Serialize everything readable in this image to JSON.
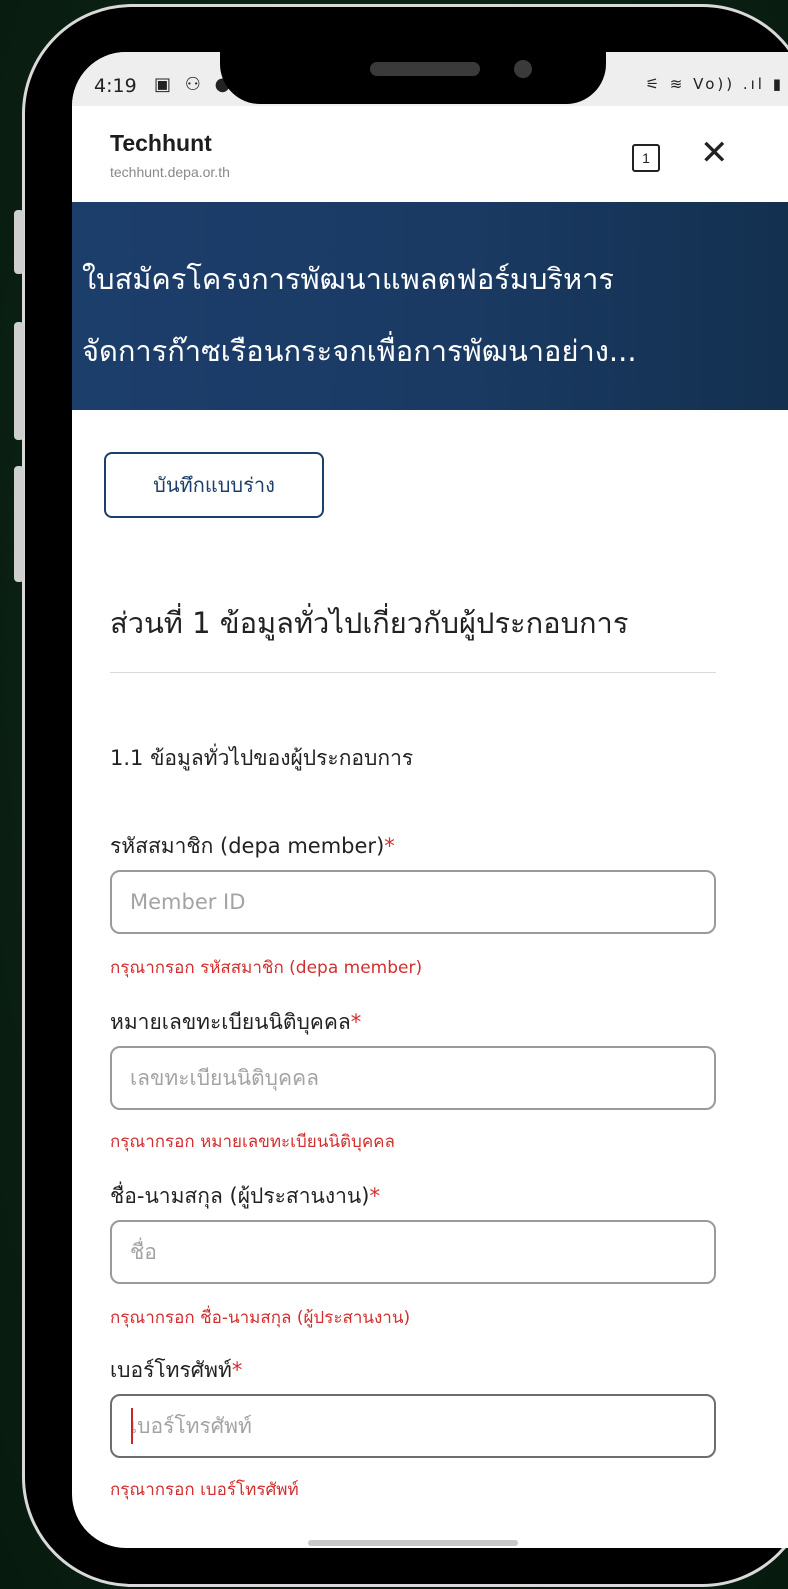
{
  "status_bar": {
    "time": "4:19",
    "left_icons": "▣ ⚇ ●",
    "right_icons": "⚟ ≋ Vo)) .ıl ▮"
  },
  "browser": {
    "title": "Techhunt",
    "url": "techhunt.depa.or.th",
    "tab_count": "1",
    "close_symbol": "✕"
  },
  "banner": {
    "line1": "ใบสมัครโครงการพัฒนาแพลตฟอร์มบริหาร",
    "line2": "จัดการก๊าซเรือนกระจกเพื่อการพัฒนาอย่าง..."
  },
  "draft_button": "บันทึกแบบร่าง",
  "section_title": "ส่วนที่ 1 ข้อมูลทั่วไปเกี่ยวกับผู้ประกอบการ",
  "subsection_title": "1.1 ข้อมูลทั่วไปของผู้ประกอบการ",
  "required_mark": "*",
  "fields": [
    {
      "label": "รหัสสมาชิก (depa member)",
      "placeholder": "Member ID",
      "error": "กรุณากรอก รหัสสมาชิก (depa member)"
    },
    {
      "label": "หมายเลขทะเบียนนิติบุคคล",
      "placeholder": "เลขทะเบียนนิติบุคคล",
      "error": "กรุณากรอก หมายเลขทะเบียนนิติบุคคล"
    },
    {
      "label": "ชื่อ-นามสกุล (ผู้ประสานงาน)",
      "placeholder": "ชื่อ",
      "error": "กรุณากรอก ชื่อ-นามสกุล (ผู้ประสานงาน)"
    },
    {
      "label": "เบอร์โทรศัพท์",
      "placeholder": "เบอร์โทรศัพท์",
      "error": "กรุณากรอก เบอร์โทรศัพท์"
    }
  ],
  "colors": {
    "banner": "#1c3e6b",
    "error": "#d32f2f",
    "background": "#0b2214"
  }
}
